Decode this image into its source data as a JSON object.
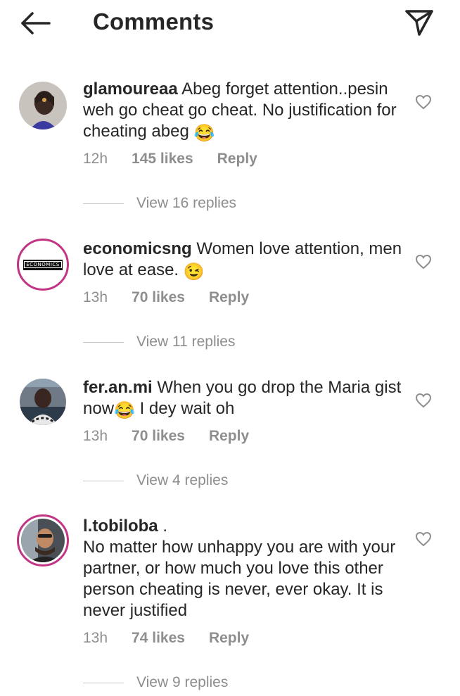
{
  "header": {
    "title": "Comments"
  },
  "comments": [
    {
      "username": "glamoureaa",
      "text": " Abeg forget attention..pesin weh go cheat go cheat. No justification for cheating abeg ",
      "emoji": "😂",
      "time": "12h",
      "likes": "145 likes",
      "reply": "Reply",
      "view_replies": "View 16 replies"
    },
    {
      "username": "economicsng",
      "text": " Women love attention, men love at ease. ",
      "emoji": "😉",
      "time": "13h",
      "likes": "70 likes",
      "reply": "Reply",
      "view_replies": "View 11 replies",
      "avatar_logo": "ECONOMICS"
    },
    {
      "username": "fer.an.mi",
      "text_before": " When you go drop the Maria gist now",
      "emoji": "😂",
      "text_after": " I dey wait oh",
      "time": "13h",
      "likes": "70 likes",
      "reply": "Reply",
      "view_replies": "View 4 replies"
    },
    {
      "username": "l.tobiloba",
      "text": " .",
      "text2": "No matter how unhappy you are with your partner, or how much you love this other person cheating is never, ever okay. It is never justified",
      "time": "13h",
      "likes": "74 likes",
      "reply": "Reply",
      "view_replies": "View 9 replies"
    }
  ],
  "colors": {
    "text": "#262626",
    "secondary": "#8e8e8e",
    "story_ring": "#c13584"
  },
  "icons": {
    "back": "arrow-left-icon",
    "share": "paper-plane-icon",
    "like": "heart-outline-icon"
  }
}
